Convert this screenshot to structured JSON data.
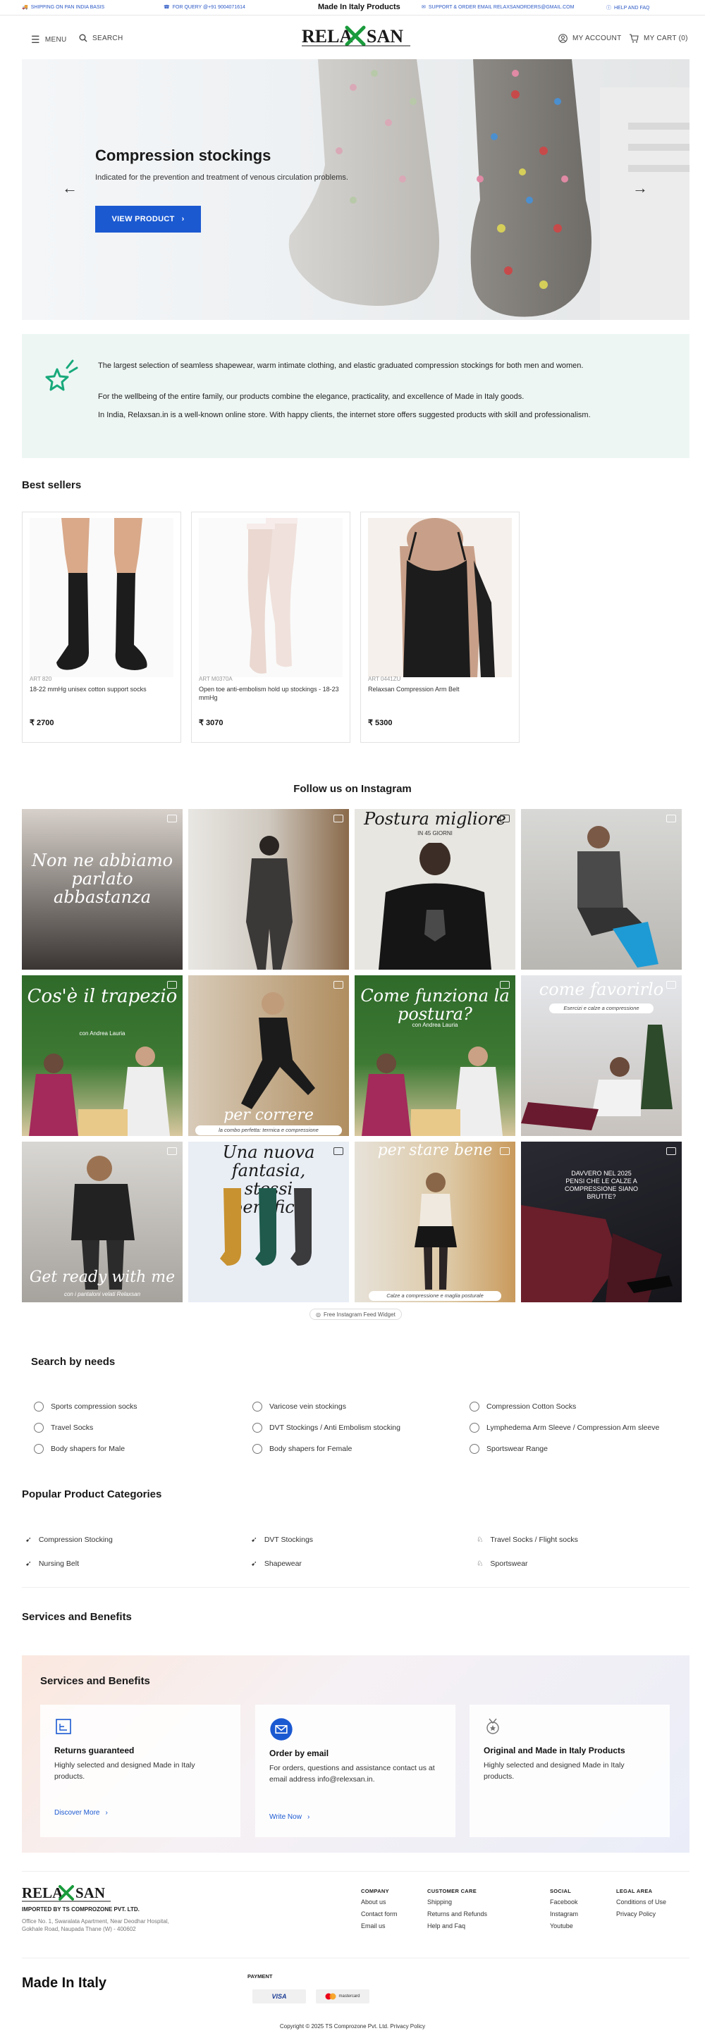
{
  "topbar": {
    "shipping": "SHIPPING ON PAN INDIA BASIS",
    "query": "FOR QUERY @+91 9004071614",
    "center": "Made In Italy Products",
    "support": "SUPPORT & ORDER EMAIL RELAXSANORDERS@GMAIL.COM",
    "help": "HELP AND FAQ"
  },
  "header": {
    "menu": "MENU",
    "search": "SEARCH",
    "logo_text": "RELAXSAN",
    "account": "MY ACCOUNT",
    "cart": "MY CART (0)"
  },
  "hero": {
    "title": "Compression stockings",
    "subtitle": "Indicated for the prevention and treatment of venous circulation problems.",
    "button": "VIEW PRODUCT",
    "prev": "←",
    "next": "→"
  },
  "info": {
    "p1": "The largest selection of seamless shapewear, warm intimate clothing, and elastic graduated compression stockings for both men and women.",
    "p2": "For the wellbeing of the entire family, our products combine the elegance, practicality, and excellence of Made in Italy goods.",
    "p3": "In India, Relaxsan.in is a well-known online store. With happy clients, the internet store offers suggested products with skill and professionalism."
  },
  "bestsellers": {
    "title": "Best sellers",
    "items": [
      {
        "code": "ART 820",
        "name": "18-22 mmHg unisex cotton support socks",
        "price": "₹ 2700"
      },
      {
        "code": "ART M0370A",
        "name": "Open toe anti-embolism hold up stockings - 18-23 mmHg",
        "price": "₹ 3070"
      },
      {
        "code": "ART 0441ZU",
        "name": "Relaxsan Compression Arm Belt",
        "price": "₹ 5300"
      }
    ]
  },
  "instagram": {
    "title": "Follow us on Instagram",
    "captions": [
      "Non ne abbiamo parlato abbastanza",
      "",
      "Postura migliore",
      "",
      "Cos'è il trapezio",
      "per correre",
      "Come funziona la postura?",
      "come favorirlo",
      "Get ready with me",
      "Una nuova fantasia, stessi benefici.",
      "per stare bene",
      "DAVVERO NEL 2025 PENSI CHE LE CALZE A COMPRESSIONE SIANO BRUTTE?"
    ],
    "sub_captions": [
      "IN 45 GIORNI",
      "con Andrea Lauria",
      "la combo perfetta: termica e compressione",
      "con Andrea Lauria",
      "Esercizi e calze a compressione",
      "con i pantaloni velati Relaxsan",
      "Calze a compressione e maglia posturale"
    ],
    "widget": "Free Instagram Feed Widget"
  },
  "needs": {
    "title": "Search by needs",
    "items": [
      "Sports compression socks",
      "Varicose vein stockings",
      "Compression Cotton Socks",
      "Travel Socks",
      "DVT Stockings / Anti Embolism stocking",
      "Lymphedema Arm Sleeve / Compression Arm sleeve",
      "Body shapers for Male",
      "Body shapers for Female",
      "Sportswear Range"
    ]
  },
  "categories": {
    "title": "Popular Product Categories",
    "items": [
      "Compression Stocking",
      "DVT Stockings",
      "Travel Socks / Flight socks",
      "Nursing Belt",
      "Shapewear",
      "Sportswear"
    ]
  },
  "services": {
    "section_title": "Services and Benefits",
    "inner_title": "Services and Benefits",
    "cards": [
      {
        "title": "Returns guaranteed",
        "text": "Highly selected and designed Made in Italy products.",
        "link": "Discover More"
      },
      {
        "title": "Order by email",
        "text": "For orders, questions and assistance contact us at email address info@relexsan.in.",
        "link": "Write Now"
      },
      {
        "title": "Original and Made in Italy Products",
        "text": "Highly selected and designed Made in Italy products.",
        "link": ""
      }
    ]
  },
  "footer": {
    "logo_text": "RELAXSAN",
    "importer": "IMPORTED BY TS COMPROZONE PVT. LTD.",
    "address": "Office No. 1, Swaralata Apartment, Near Deodhar Hospital, Gokhale Road, Naupada Thane (W) - 400602",
    "company": {
      "title": "COMPANY",
      "links": [
        "About us",
        "Contact form",
        "Email us"
      ]
    },
    "customer": {
      "title": "CUSTOMER CARE",
      "links": [
        "Shipping",
        "Returns and Refunds",
        "Help and Faq"
      ]
    },
    "social": {
      "title": "SOCIAL",
      "links": [
        "Facebook",
        "Instagram",
        "Youtube"
      ]
    },
    "legal": {
      "title": "LEGAL AREA",
      "links": [
        "Conditions of Use",
        "Privacy Policy"
      ]
    },
    "made_in": "Made In Italy",
    "payment": "PAYMENT",
    "visa": "VISA",
    "mastercard": "mastercard",
    "copyright": "Copyright © 2025 TS Comprozone Pvt. Ltd. Privacy Policy"
  },
  "colors": {
    "accent": "#1b59d1",
    "info_bg": "#eef6f4",
    "logo_green": "#1a9b3c",
    "logo_dark": "#1a1a1a"
  }
}
